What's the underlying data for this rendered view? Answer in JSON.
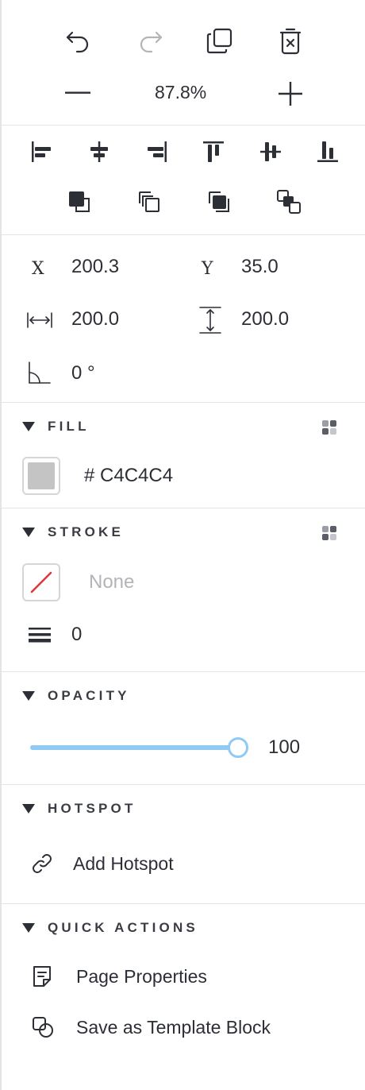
{
  "zoom": {
    "value": "87.8%"
  },
  "transform": {
    "x_label": "X",
    "x_value": "200.3",
    "y_label": "Y",
    "y_value": "35.0",
    "width_value": "200.0",
    "height_value": "200.0",
    "rotation_value": "0 °"
  },
  "fill": {
    "title": "FILL",
    "color_text": "# C4C4C4",
    "color": "#C4C4C4"
  },
  "stroke": {
    "title": "STROKE",
    "color_text": "None",
    "width_value": "0"
  },
  "opacity": {
    "title": "OPACITY",
    "value": "100",
    "level_percent": 100,
    "track_color": "#8fcaf5"
  },
  "hotspot": {
    "title": "HOTSPOT",
    "add_label": "Add Hotspot"
  },
  "quick_actions": {
    "title": "QUICK ACTIONS",
    "items": [
      {
        "label": "Page Properties",
        "icon": "page-properties-icon"
      },
      {
        "label": "Save as Template Block",
        "icon": "template-block-icon"
      }
    ]
  },
  "colors": {
    "text": "#2d2f36",
    "muted": "#b4b4b8",
    "accent": "#8fcaf5",
    "danger": "#d93a3a"
  }
}
